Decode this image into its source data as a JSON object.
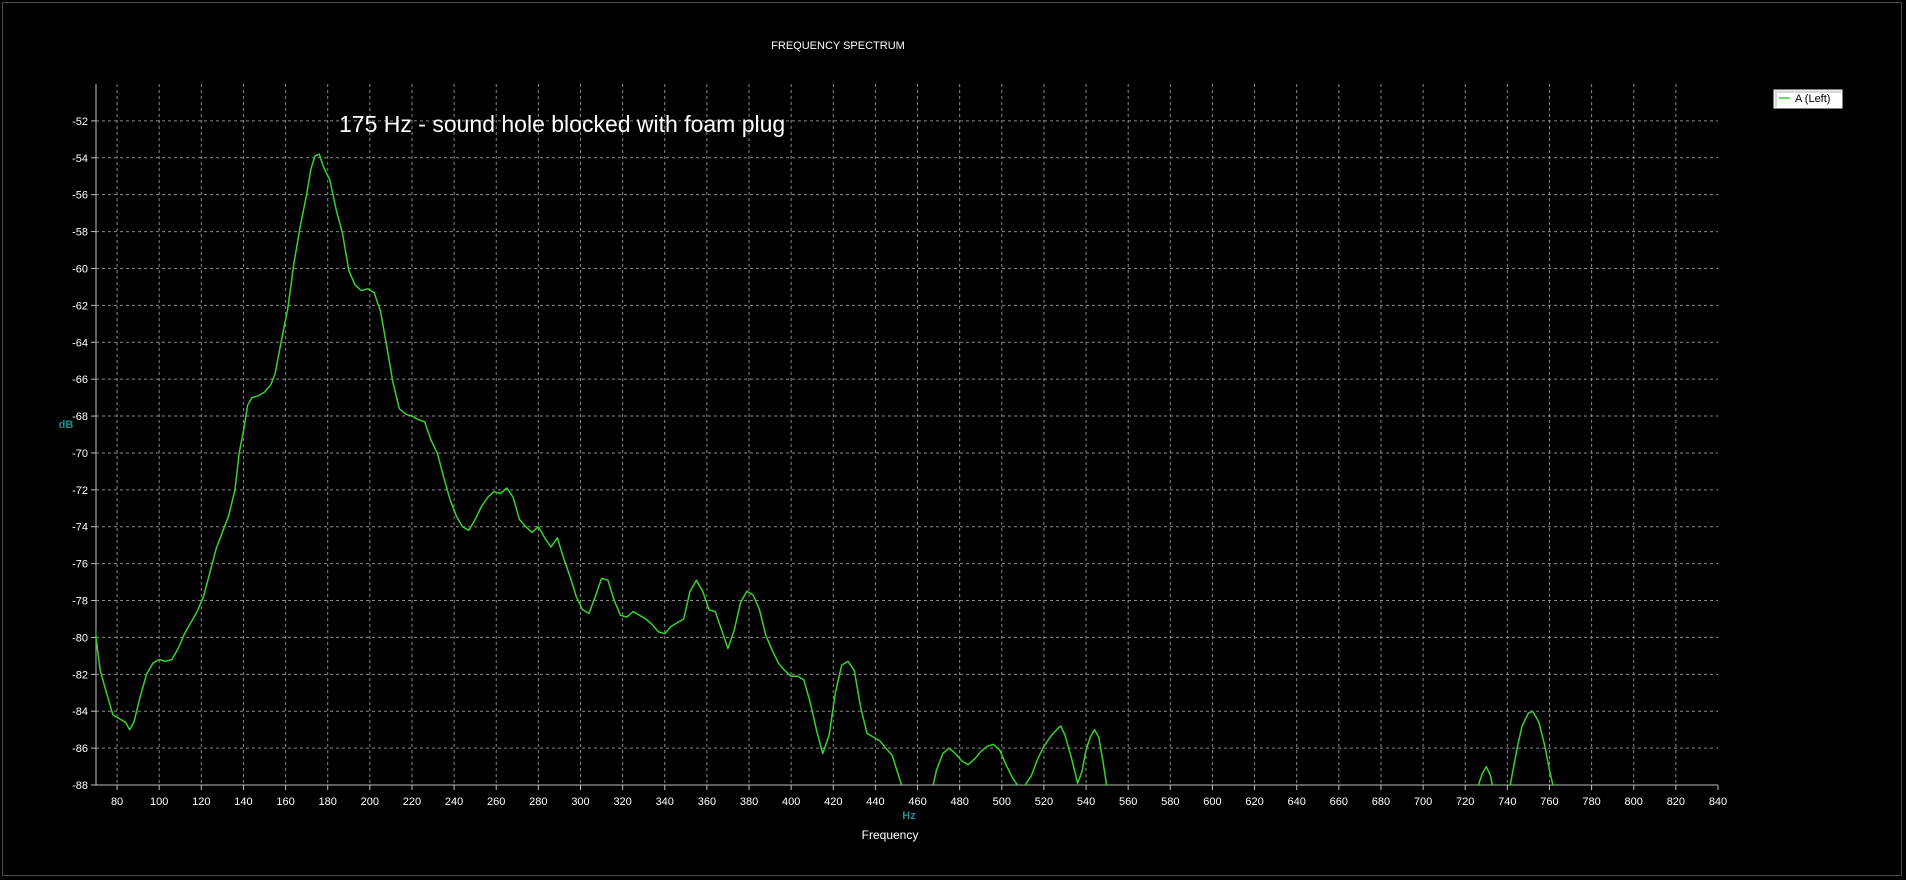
{
  "chart_data": {
    "type": "line",
    "title": "FREQUENCY SPECTRUM",
    "annotation": "175 Hz - sound hole blocked with foam plug",
    "xlabel": "Frequency",
    "xunit": "Hz",
    "ylabel": "dB",
    "xlim": [
      70,
      840
    ],
    "ylim": [
      -88,
      -50
    ],
    "x_ticks": [
      80,
      100,
      120,
      140,
      160,
      180,
      200,
      220,
      240,
      260,
      280,
      300,
      320,
      340,
      360,
      380,
      400,
      420,
      440,
      460,
      480,
      500,
      520,
      540,
      560,
      580,
      600,
      620,
      640,
      660,
      680,
      700,
      720,
      740,
      760,
      780,
      800,
      820,
      840
    ],
    "y_ticks": [
      -52,
      -54,
      -56,
      -58,
      -60,
      -62,
      -64,
      -66,
      -68,
      -70,
      -72,
      -74,
      -76,
      -78,
      -80,
      -82,
      -84,
      -86,
      -88
    ],
    "grid": true,
    "legend_position": "top-right",
    "colors": {
      "series": "#39d12f",
      "grid": "#8a8a8a",
      "axis": "#bdbdbd"
    },
    "series": [
      {
        "name": "A (Left)",
        "segments": [
          [
            [
              69,
              -78.5
            ],
            [
              70,
              -80
            ],
            [
              72,
              -81.8
            ],
            [
              75,
              -83
            ],
            [
              78,
              -84.2
            ],
            [
              81,
              -84.4
            ],
            [
              84,
              -84.6
            ],
            [
              86,
              -85
            ],
            [
              88,
              -84.6
            ],
            [
              91,
              -83.2
            ],
            [
              94,
              -82
            ],
            [
              97,
              -81.4
            ],
            [
              100,
              -81.2
            ],
            [
              103,
              -81.3
            ],
            [
              106,
              -81.2
            ],
            [
              109,
              -80.6
            ],
            [
              112,
              -79.8
            ],
            [
              115,
              -79.2
            ],
            [
              118,
              -78.6
            ],
            [
              121,
              -77.8
            ],
            [
              124,
              -76.5
            ],
            [
              127,
              -75.2
            ],
            [
              130,
              -74.3
            ],
            [
              133,
              -73.4
            ],
            [
              136,
              -72
            ],
            [
              138,
              -70
            ],
            [
              140,
              -68.8
            ],
            [
              142,
              -67.4
            ],
            [
              144,
              -67
            ],
            [
              147,
              -66.9
            ],
            [
              150,
              -66.7
            ],
            [
              153,
              -66.3
            ],
            [
              155,
              -65.7
            ],
            [
              158,
              -63.9
            ],
            [
              161,
              -62.2
            ],
            [
              164,
              -59.7
            ],
            [
              167,
              -57.7
            ],
            [
              170,
              -56
            ],
            [
              172,
              -54.6
            ],
            [
              174,
              -53.9
            ],
            [
              176,
              -53.8
            ],
            [
              178,
              -54.5
            ],
            [
              181,
              -55.2
            ],
            [
              184,
              -56.8
            ],
            [
              187,
              -58.1
            ],
            [
              190,
              -60.1
            ],
            [
              193,
              -60.9
            ],
            [
              196,
              -61.2
            ],
            [
              199,
              -61.1
            ],
            [
              202,
              -61.3
            ],
            [
              205,
              -62.3
            ],
            [
              208,
              -64.2
            ],
            [
              211,
              -66.2
            ],
            [
              214,
              -67.6
            ],
            [
              217,
              -67.9
            ],
            [
              220,
              -68
            ],
            [
              223,
              -68.2
            ],
            [
              226,
              -68.3
            ],
            [
              229,
              -69.3
            ],
            [
              232,
              -70
            ],
            [
              235,
              -71.3
            ],
            [
              238,
              -72.5
            ],
            [
              241,
              -73.4
            ],
            [
              244,
              -74
            ],
            [
              247,
              -74.2
            ],
            [
              250,
              -73.6
            ],
            [
              253,
              -72.9
            ],
            [
              256,
              -72.4
            ],
            [
              259,
              -72.1
            ],
            [
              262,
              -72.2
            ],
            [
              265,
              -71.9
            ],
            [
              268,
              -72.4
            ],
            [
              271,
              -73.6
            ],
            [
              274,
              -74
            ],
            [
              277,
              -74.3
            ],
            [
              280,
              -74
            ],
            [
              283,
              -74.6
            ],
            [
              286,
              -75.1
            ],
            [
              289,
              -74.6
            ],
            [
              292,
              -75.7
            ],
            [
              295,
              -76.7
            ],
            [
              298,
              -77.8
            ],
            [
              301,
              -78.5
            ],
            [
              304,
              -78.7
            ],
            [
              307,
              -77.8
            ],
            [
              310,
              -76.8
            ],
            [
              313,
              -76.9
            ],
            [
              316,
              -78
            ],
            [
              319,
              -78.8
            ],
            [
              322,
              -78.9
            ],
            [
              325,
              -78.6
            ],
            [
              328,
              -78.8
            ],
            [
              331,
              -79
            ],
            [
              334,
              -79.3
            ],
            [
              337,
              -79.7
            ],
            [
              340,
              -79.8
            ],
            [
              343,
              -79.4
            ],
            [
              346,
              -79.2
            ],
            [
              349,
              -79
            ],
            [
              352,
              -77.5
            ],
            [
              355,
              -76.9
            ],
            [
              358,
              -77.5
            ],
            [
              361,
              -78.5
            ],
            [
              364,
              -78.6
            ],
            [
              367,
              -79.6
            ],
            [
              370,
              -80.6
            ],
            [
              373,
              -79.6
            ],
            [
              376,
              -78.1
            ],
            [
              379,
              -77.5
            ],
            [
              382,
              -77.7
            ],
            [
              385,
              -78.5
            ],
            [
              388,
              -79.9
            ],
            [
              391,
              -80.7
            ],
            [
              394,
              -81.4
            ],
            [
              397,
              -81.8
            ],
            [
              400,
              -82.1
            ],
            [
              403,
              -82.1
            ],
            [
              406,
              -82.3
            ],
            [
              409,
              -83.5
            ],
            [
              412,
              -85
            ],
            [
              415,
              -86.3
            ],
            [
              418,
              -85.3
            ],
            [
              421,
              -83
            ],
            [
              424,
              -81.5
            ],
            [
              427,
              -81.3
            ],
            [
              430,
              -81.8
            ],
            [
              433,
              -83.8
            ],
            [
              436,
              -85.2
            ],
            [
              439,
              -85.4
            ],
            [
              442,
              -85.6
            ],
            [
              445,
              -86
            ],
            [
              448,
              -86.4
            ],
            [
              451,
              -87.5
            ],
            [
              453,
              -88.2
            ]
          ],
          [
            [
              467,
              -88.2
            ],
            [
              469,
              -87.2
            ],
            [
              472,
              -86.3
            ],
            [
              475,
              -86
            ],
            [
              478,
              -86.3
            ],
            [
              481,
              -86.7
            ],
            [
              484,
              -86.9
            ],
            [
              487,
              -86.6
            ],
            [
              490,
              -86.2
            ],
            [
              493,
              -85.9
            ],
            [
              496,
              -85.8
            ],
            [
              499,
              -86.1
            ],
            [
              502,
              -86.9
            ],
            [
              505,
              -87.6
            ],
            [
              508,
              -88.1
            ],
            [
              511,
              -88
            ],
            [
              514,
              -87.5
            ],
            [
              517,
              -86.6
            ],
            [
              520,
              -85.9
            ],
            [
              523,
              -85.4
            ],
            [
              526,
              -85
            ],
            [
              528,
              -84.8
            ],
            [
              530,
              -85.3
            ],
            [
              533,
              -86.5
            ],
            [
              536,
              -87.9
            ],
            [
              538,
              -87.3
            ],
            [
              540,
              -86.1
            ],
            [
              542,
              -85.4
            ],
            [
              544,
              -85
            ],
            [
              546,
              -85.4
            ],
            [
              548,
              -86.7
            ],
            [
              550,
              -88.2
            ]
          ],
          [
            [
              726,
              -88.1
            ],
            [
              728,
              -87.4
            ],
            [
              730,
              -87
            ],
            [
              732,
              -87.5
            ],
            [
              733,
              -88.1
            ]
          ],
          [
            [
              741,
              -88.2
            ],
            [
              743,
              -87
            ],
            [
              745,
              -85.8
            ],
            [
              747,
              -84.8
            ],
            [
              750,
              -84.1
            ],
            [
              752,
              -84
            ],
            [
              755,
              -84.6
            ],
            [
              758,
              -86
            ],
            [
              760,
              -87.2
            ],
            [
              762,
              -88.2
            ]
          ]
        ]
      }
    ]
  }
}
